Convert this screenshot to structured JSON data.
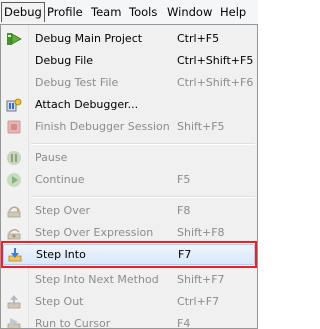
{
  "menubar": {
    "items": [
      {
        "label": "Debug",
        "active": true
      },
      {
        "label": "Profile"
      },
      {
        "label": "Team"
      },
      {
        "label": "Tools"
      },
      {
        "label": "Window"
      },
      {
        "label": "Help"
      }
    ]
  },
  "debug_menu": {
    "items": [
      {
        "label": "Debug Main Project",
        "shortcut": "Ctrl+F5",
        "enabled": true,
        "icon": "debug-main-project-icon"
      },
      {
        "label": "Debug File",
        "shortcut": "Ctrl+Shift+F5",
        "enabled": true,
        "icon": "none"
      },
      {
        "label": "Debug Test File",
        "shortcut": "Ctrl+Shift+F6",
        "enabled": false,
        "icon": "none"
      },
      {
        "label": "Attach Debugger...",
        "shortcut": "",
        "enabled": true,
        "icon": "attach-debugger-icon"
      },
      {
        "label": "Finish Debugger Session",
        "shortcut": "Shift+F5",
        "enabled": false,
        "icon": "finish-session-icon"
      },
      {
        "label": "Pause",
        "shortcut": "",
        "enabled": false,
        "icon": "pause-icon"
      },
      {
        "label": "Continue",
        "shortcut": "F5",
        "enabled": false,
        "icon": "continue-icon"
      },
      {
        "label": "Step Over",
        "shortcut": "F8",
        "enabled": false,
        "icon": "step-over-icon"
      },
      {
        "label": "Step Over Expression",
        "shortcut": "Shift+F8",
        "enabled": false,
        "icon": "step-over-expression-icon"
      },
      {
        "label": "Step Into",
        "shortcut": "F7",
        "enabled": true,
        "icon": "step-into-icon",
        "highlighted": true
      },
      {
        "label": "Step Into Next Method",
        "shortcut": "Shift+F7",
        "enabled": false,
        "icon": "none"
      },
      {
        "label": "Step Out",
        "shortcut": "Ctrl+F7",
        "enabled": false,
        "icon": "step-out-icon"
      },
      {
        "label": "Run to Cursor",
        "shortcut": "F4",
        "enabled": false,
        "icon": "run-to-cursor-icon"
      }
    ]
  },
  "colors": {
    "highlight_outline": "#e8212b",
    "disabled_text": "#8c8c8c"
  }
}
